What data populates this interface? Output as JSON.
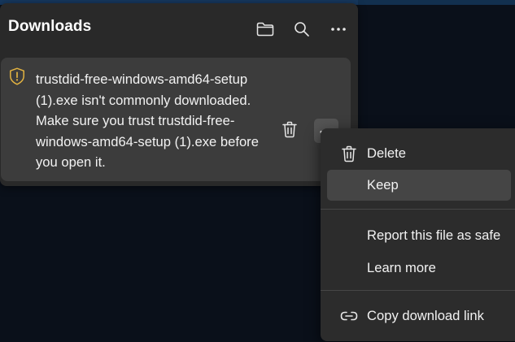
{
  "panel": {
    "title": "Downloads",
    "header_icons": [
      "folder-icon",
      "search-icon",
      "more-icon"
    ]
  },
  "download_item": {
    "warning_icon": "shield-warning-icon",
    "message_lines": [
      "trustdid-free-windows-amd64-setup",
      "(1).exe isn't commonly downloaded.",
      "Make sure you trust trustdid-free-",
      "windows-amd64-setup (1).exe before",
      "you open it."
    ]
  },
  "context_menu": {
    "items": [
      {
        "label": "Delete",
        "icon": "trash-icon"
      },
      {
        "label": "Keep",
        "icon": ""
      },
      {
        "label": "Report this file as safe",
        "icon": ""
      },
      {
        "label": "Learn more",
        "icon": ""
      },
      {
        "label": "Copy download link",
        "icon": "link-icon"
      }
    ]
  },
  "colors": {
    "panel_bg": "#292929",
    "card_bg": "#3c3c3c",
    "menu_bg": "#2c2c2c",
    "hover_bg": "#454545",
    "warning": "#e3b341",
    "text": "#f2f2f2"
  }
}
